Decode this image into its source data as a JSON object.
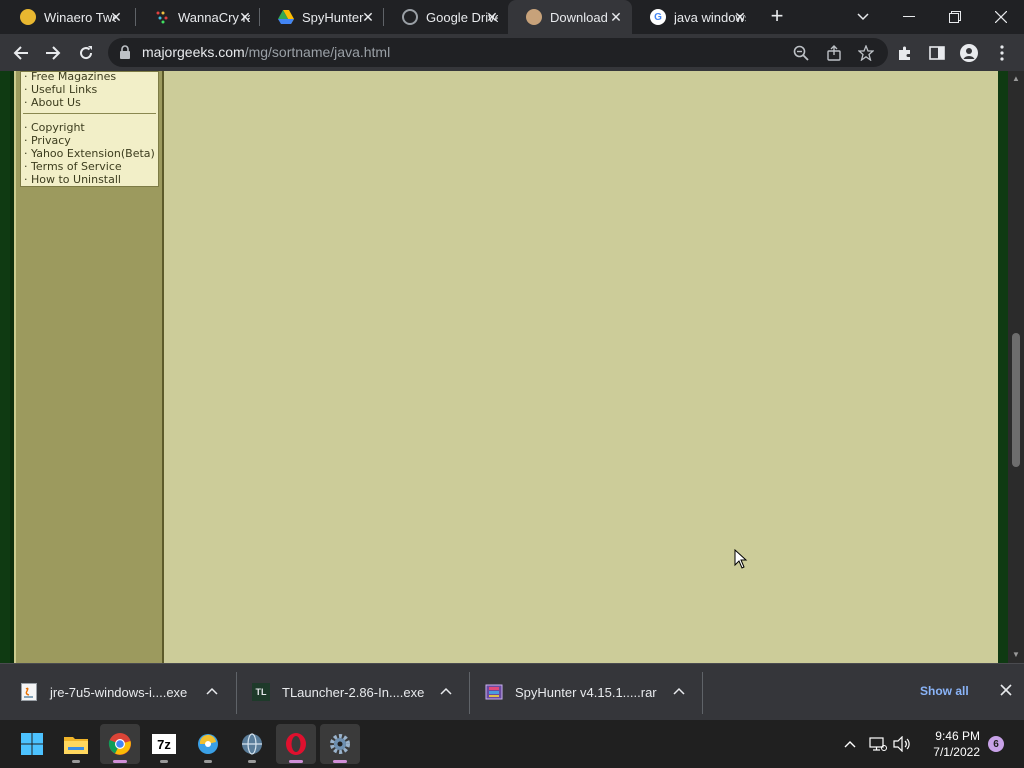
{
  "browser": {
    "tabs": [
      {
        "title": "Winaero Tweaker",
        "active": false,
        "favicon": "winaero-icon",
        "color": "#e8b730"
      },
      {
        "title": "WannaCry ransomware",
        "active": false,
        "favicon": "wannacry-icon",
        "color": "#e04040"
      },
      {
        "title": "SpyHunter",
        "active": false,
        "favicon": "google-drive-icon",
        "color": "#34a853"
      },
      {
        "title": "Google Drive",
        "active": false,
        "favicon": "globe-icon",
        "color": "#9aa0a6"
      },
      {
        "title": "Download",
        "active": true,
        "favicon": "majorgeeks-icon",
        "color": "#c7a27a"
      },
      {
        "title": "java windows",
        "active": false,
        "favicon": "google-icon",
        "color": "#4285f4"
      }
    ],
    "url": {
      "domain": "majorgeeks.com",
      "path": "/mg/sortname/java.html"
    }
  },
  "sidebar_menu": {
    "group1": [
      "· Free Magazines",
      "· Useful Links",
      "· About Us"
    ],
    "group2": [
      "· Copyright",
      "· Privacy",
      "· Yahoo Extension(Beta)",
      "· Terms of Service",
      "· How to Uninstall"
    ]
  },
  "downloads": {
    "items": [
      {
        "name": "jre-7u5-windows-i....exe",
        "icon": "java-file-icon"
      },
      {
        "name": "TLauncher-2.86-In....exe",
        "icon": "tlauncher-file-icon",
        "icon_text": "TL"
      },
      {
        "name": "SpyHunter v4.15.1.....rar",
        "icon": "rar-archive-icon"
      }
    ],
    "show_all": "Show all"
  },
  "taskbar": {
    "time": "9:46 PM",
    "date": "7/1/2022",
    "notification_count": "6",
    "sevenzip_label": "7z"
  },
  "colors": {
    "page_bg": "#cccc99",
    "sidebar_bg": "#9c9a5e",
    "frame_green": "#0f3a12",
    "accent_link": "#8ab4f8"
  }
}
